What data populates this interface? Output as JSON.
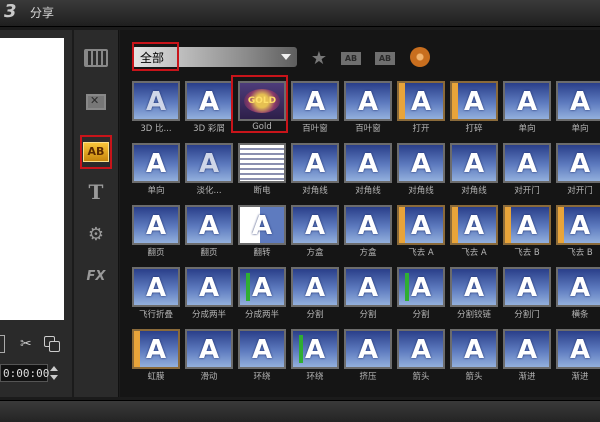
{
  "window": {
    "step_number": "3",
    "step_label": "分享"
  },
  "player": {
    "timecode": "0:00:00"
  },
  "categories": [
    {
      "id": "media",
      "icon": "media-icon"
    },
    {
      "id": "transition",
      "icon": "film-transition-icon"
    },
    {
      "id": "title-ab",
      "icon": "ab-title-icon",
      "label": "AB",
      "selected": true
    },
    {
      "id": "title",
      "icon": "title-t-icon",
      "label": "T"
    },
    {
      "id": "graphic",
      "icon": "graphic-gear-icon"
    },
    {
      "id": "filter",
      "icon": "fx-filter-icon",
      "label": "FX"
    }
  ],
  "library": {
    "filter_value": "全部"
  },
  "toolbar": {
    "icons": [
      "add-favorite-star-icon",
      "apply-to-all-icon",
      "apply-to-video-icon",
      "film-reel-icon"
    ],
    "ab_label": "AB"
  },
  "effects": [
    {
      "label": "3D 比...",
      "style": "dim"
    },
    {
      "label": "3D 彩屑",
      "style": "default"
    },
    {
      "label": "Gold",
      "style": "gold",
      "badge": "GOLD",
      "selected": true
    },
    {
      "label": "百叶窗",
      "style": "default"
    },
    {
      "label": "百叶窗",
      "style": "default"
    },
    {
      "label": "打开",
      "style": "edge"
    },
    {
      "label": "打碎",
      "style": "edge"
    },
    {
      "label": "单向",
      "style": "default"
    },
    {
      "label": "单向",
      "style": "default"
    },
    {
      "label": "单向",
      "style": "default"
    },
    {
      "label": "淡化...",
      "style": "dim"
    },
    {
      "label": "断电",
      "style": "news"
    },
    {
      "label": "对角线",
      "style": "default"
    },
    {
      "label": "对角线",
      "style": "default"
    },
    {
      "label": "对角线",
      "style": "default"
    },
    {
      "label": "对角线",
      "style": "default"
    },
    {
      "label": "对开门",
      "style": "default"
    },
    {
      "label": "对开门",
      "style": "default"
    },
    {
      "label": "翻页",
      "style": "default"
    },
    {
      "label": "翻页",
      "style": "default"
    },
    {
      "label": "翻转",
      "style": "flip"
    },
    {
      "label": "方盒",
      "style": "default"
    },
    {
      "label": "方盒",
      "style": "default"
    },
    {
      "label": "飞去 A",
      "style": "edge"
    },
    {
      "label": "飞去 A",
      "style": "edge"
    },
    {
      "label": "飞去 B",
      "style": "edge"
    },
    {
      "label": "飞去 B",
      "style": "edge"
    },
    {
      "label": "飞行折叠",
      "style": "default"
    },
    {
      "label": "分成两半",
      "style": "default"
    },
    {
      "label": "分成两半",
      "style": "green"
    },
    {
      "label": "分割",
      "style": "default"
    },
    {
      "label": "分割",
      "style": "default"
    },
    {
      "label": "分割",
      "style": "green"
    },
    {
      "label": "分割铰链",
      "style": "default"
    },
    {
      "label": "分割门",
      "style": "default"
    },
    {
      "label": "横条",
      "style": "default"
    },
    {
      "label": "虹膜",
      "style": "edge"
    },
    {
      "label": "滑动",
      "style": "default"
    },
    {
      "label": "环绕",
      "style": "default"
    },
    {
      "label": "环绕",
      "style": "green"
    },
    {
      "label": "挤压",
      "style": "default"
    },
    {
      "label": "箭头",
      "style": "default"
    },
    {
      "label": "箭头",
      "style": "default"
    },
    {
      "label": "渐进",
      "style": "default"
    },
    {
      "label": "渐进",
      "style": "default"
    }
  ]
}
